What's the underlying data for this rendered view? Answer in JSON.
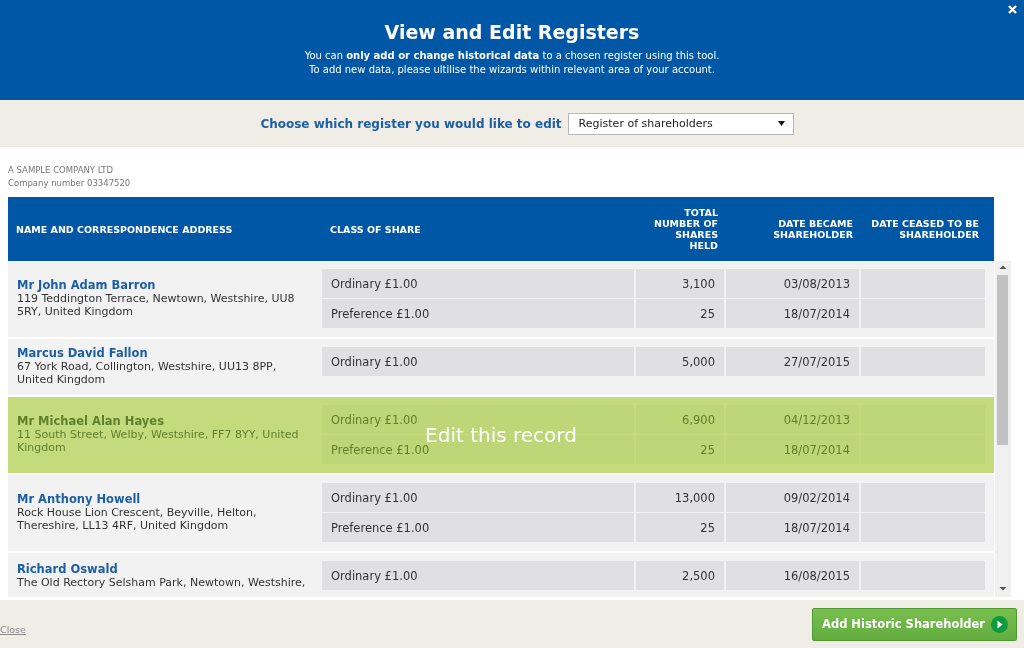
{
  "header": {
    "title": "View and Edit Registers",
    "lines": [
      "You can **only add or change historical data** to a chosen register using this tool.",
      "To add new data, please ultilise the wizards within relevant area of your account."
    ]
  },
  "selector": {
    "label": "Choose which register you would like to edit",
    "value": "Register of shareholders"
  },
  "company": {
    "name": "A SAMPLE COMPANY LTD",
    "number": "Company number 03347520"
  },
  "table": {
    "columns": [
      "NAME AND CORRESPONDENCE ADDRESS",
      "CLASS OF SHARE",
      "TOTAL NUMBER OF SHARES HELD",
      "DATE BECAME SHAREHOLDER",
      "DATE CEASED TO BE SHAREHOLDER"
    ],
    "edit_overlay": "Edit this record",
    "rows": [
      {
        "name": "Mr John Adam Barron",
        "address": "119 Teddington Terrace, Newtown, Westshire, UU8 5RY, United Kingdom",
        "highlighted": false,
        "shares": [
          {
            "class": "Ordinary £1.00",
            "total": "3,100",
            "became": "03/08/2013"
          },
          {
            "class": "Preference £1.00",
            "total": "25",
            "became": "18/07/2014"
          }
        ]
      },
      {
        "name": "Marcus David Fallon",
        "address": "67 York Road, Collington, Westshire, UU13 8PP, United Kingdom",
        "highlighted": false,
        "shares": [
          {
            "class": "Ordinary £1.00",
            "total": "5,000",
            "became": "27/07/2015"
          }
        ]
      },
      {
        "name": "Mr Michael Alan Hayes",
        "address": "11 South Street, Welby, Westshire, FF7 8YY, United Kingdom",
        "highlighted": true,
        "shares": [
          {
            "class": "Ordinary £1.00",
            "total": "6,900",
            "became": "04/12/2013"
          },
          {
            "class": "Preference £1.00",
            "total": "25",
            "became": "18/07/2014"
          }
        ]
      },
      {
        "name": "Mr Anthony Howell",
        "address": "Rock House Lion Crescent, Beyville, Helton, Thereshire, LL13 4RF, United Kingdom",
        "highlighted": false,
        "shares": [
          {
            "class": "Ordinary £1.00",
            "total": "13,000",
            "became": "09/02/2014"
          },
          {
            "class": "Preference £1.00",
            "total": "25",
            "became": "18/07/2014"
          }
        ]
      },
      {
        "name": "Richard Oswald",
        "address": "The Old Rectory Selsham Park, Newtown, Westshire,",
        "highlighted": false,
        "shares": [
          {
            "class": "Ordinary £1.00",
            "total": "2,500",
            "became": "16/08/2015"
          }
        ]
      }
    ]
  },
  "footer": {
    "close": "Close",
    "add_button": "Add Historic Shareholder"
  }
}
